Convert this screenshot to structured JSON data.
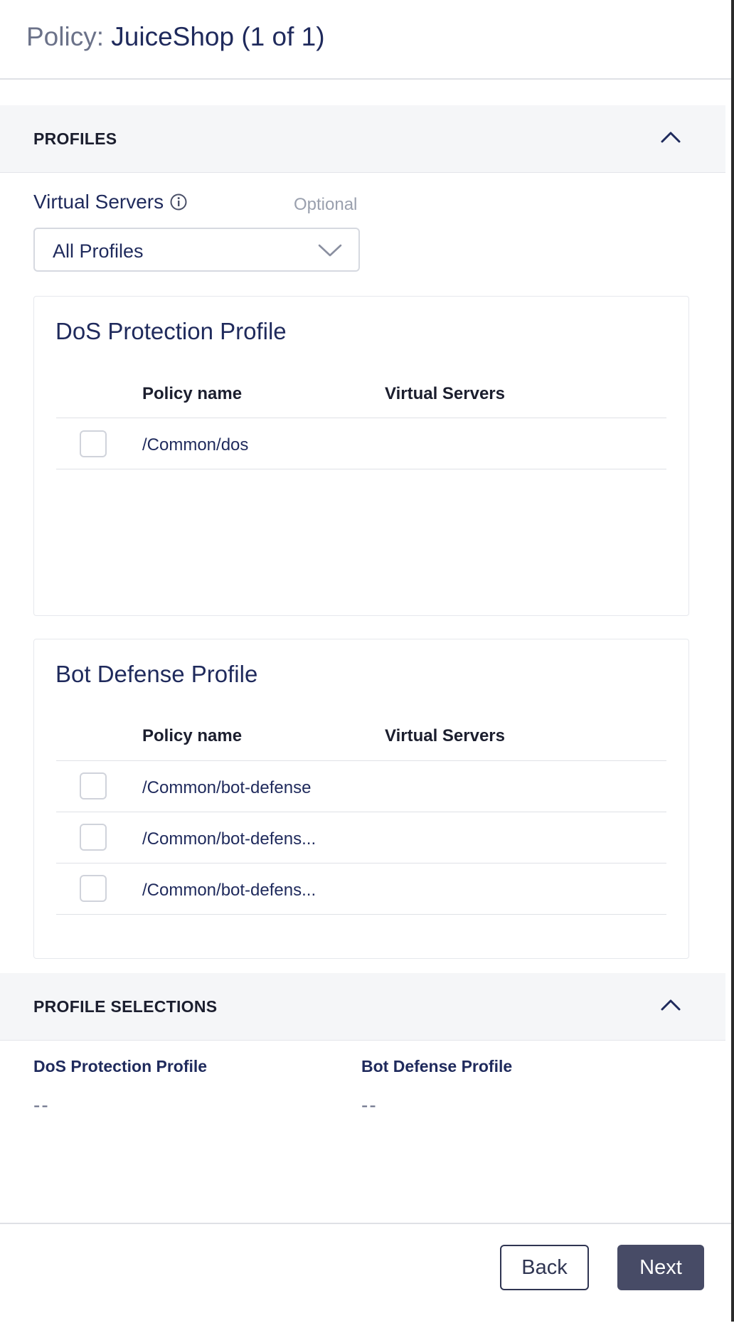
{
  "header": {
    "title_prefix": "Policy:",
    "title_name": "JuiceShop (1 of 1)"
  },
  "profiles_section": {
    "heading": "PROFILES",
    "virtual_servers": {
      "label": "Virtual Servers",
      "optional": "Optional",
      "selected": "All Profiles"
    },
    "dos_card": {
      "title": "DoS Protection Profile",
      "col_policy": "Policy name",
      "col_vs": "Virtual Servers",
      "rows": [
        {
          "policy": "/Common/dos",
          "vs": ""
        }
      ]
    },
    "bot_card": {
      "title": "Bot Defense Profile",
      "col_policy": "Policy name",
      "col_vs": "Virtual Servers",
      "rows": [
        {
          "policy": "/Common/bot-defense",
          "vs": ""
        },
        {
          "policy": "/Common/bot-defens...",
          "vs": ""
        },
        {
          "policy": "/Common/bot-defens...",
          "vs": ""
        }
      ]
    }
  },
  "selections_section": {
    "heading": "PROFILE SELECTIONS",
    "dos_label": "DoS Protection Profile",
    "dos_value": "--",
    "bot_label": "Bot Defense Profile",
    "bot_value": "--"
  },
  "footer": {
    "back_label": "Back",
    "next_label": "Next"
  },
  "icons": {
    "collapse": "chevron-up-icon",
    "info": "info-icon",
    "dropdown": "chevron-down-icon"
  },
  "colors": {
    "primary_button": "#474b66",
    "text_navy": "#1f2a5c",
    "section_bg": "#f5f6f8"
  }
}
